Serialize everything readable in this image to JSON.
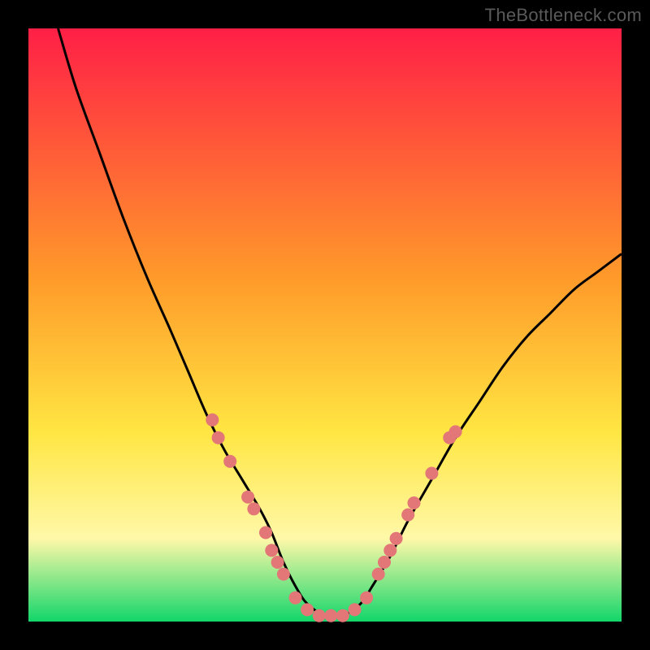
{
  "watermark": "TheBottleneck.com",
  "colors": {
    "gradient_top": "#ff1f46",
    "gradient_mid1": "#ff9a2a",
    "gradient_mid2": "#ffe642",
    "gradient_mid3": "#fff8a8",
    "gradient_bottom": "#12d66a",
    "stroke": "#000000",
    "marker": "#e37676",
    "frame": "#000000"
  },
  "chart_data": {
    "type": "line",
    "title": "",
    "xlabel": "",
    "ylabel": "",
    "xlim": [
      0,
      100
    ],
    "ylim": [
      0,
      100
    ],
    "series": [
      {
        "name": "bottleneck-curve",
        "x": [
          5,
          8,
          12,
          16,
          20,
          24,
          27,
          30,
          33,
          36,
          39,
          41,
          43,
          45,
          47,
          50,
          53,
          56,
          58,
          61,
          64,
          68,
          72,
          76,
          80,
          84,
          88,
          92,
          96,
          100
        ],
        "y": [
          100,
          90,
          79,
          68,
          58,
          49,
          42,
          35,
          29,
          24,
          19,
          15,
          10,
          6,
          3,
          1,
          1,
          3,
          6,
          11,
          17,
          24,
          31,
          37,
          43,
          48,
          52,
          56,
          59,
          62
        ]
      }
    ],
    "markers": [
      {
        "x": 31,
        "y": 34
      },
      {
        "x": 32,
        "y": 31
      },
      {
        "x": 34,
        "y": 27
      },
      {
        "x": 37,
        "y": 21
      },
      {
        "x": 38,
        "y": 19
      },
      {
        "x": 40,
        "y": 15
      },
      {
        "x": 41,
        "y": 12
      },
      {
        "x": 42,
        "y": 10
      },
      {
        "x": 43,
        "y": 8
      },
      {
        "x": 45,
        "y": 4
      },
      {
        "x": 47,
        "y": 2
      },
      {
        "x": 49,
        "y": 1
      },
      {
        "x": 51,
        "y": 1
      },
      {
        "x": 53,
        "y": 1
      },
      {
        "x": 55,
        "y": 2
      },
      {
        "x": 57,
        "y": 4
      },
      {
        "x": 59,
        "y": 8
      },
      {
        "x": 60,
        "y": 10
      },
      {
        "x": 61,
        "y": 12
      },
      {
        "x": 62,
        "y": 14
      },
      {
        "x": 64,
        "y": 18
      },
      {
        "x": 65,
        "y": 20
      },
      {
        "x": 68,
        "y": 25
      },
      {
        "x": 71,
        "y": 31
      },
      {
        "x": 72,
        "y": 32
      }
    ]
  }
}
